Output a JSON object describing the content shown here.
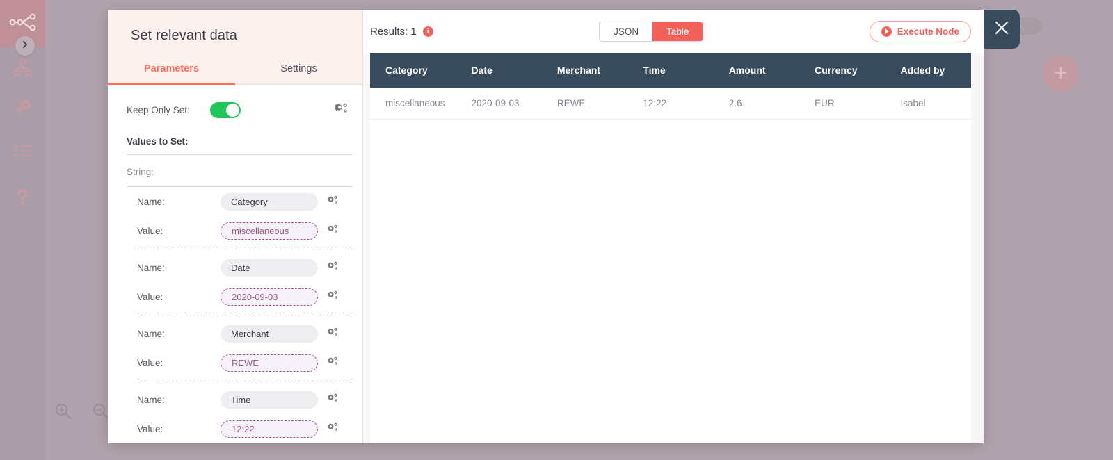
{
  "sidebar": {
    "logo_icon": "workflow-nodes-icon",
    "expand_icon": "chevron-right-icon",
    "items": [
      {
        "icon": "sitemap-icon",
        "name": "workflows"
      },
      {
        "icon": "key-icon",
        "name": "credentials"
      },
      {
        "icon": "checklist-icon",
        "name": "executions"
      },
      {
        "icon": "question-mark-icon",
        "name": "help"
      }
    ]
  },
  "canvas": {
    "zoom_in_icon": "zoom-in-icon",
    "zoom_out_icon": "zoom-out-icon",
    "add_icon": "plus-icon"
  },
  "modal": {
    "title": "Set relevant data",
    "tabs": [
      {
        "label": "Parameters",
        "active": true
      },
      {
        "label": "Settings",
        "active": false
      }
    ],
    "close_icon": "close-icon"
  },
  "parameters": {
    "keep_only_set": {
      "label": "Keep Only Set:",
      "value": "on",
      "options_icon": "cogs-icon"
    },
    "values_to_set_label": "Values to Set:",
    "string_label": "String:",
    "name_label": "Name:",
    "value_label": "Value:",
    "options_icon": "cogs-icon",
    "entries": [
      {
        "name": "Category",
        "value": "miscellaneous"
      },
      {
        "name": "Date",
        "value": "2020-09-03"
      },
      {
        "name": "Merchant",
        "value": "REWE"
      },
      {
        "name": "Time",
        "value": "12:22"
      }
    ]
  },
  "results": {
    "count_label": "Results: 1",
    "info_icon": "info-icon",
    "info_glyph": "i",
    "views": [
      {
        "label": "JSON",
        "active": false
      },
      {
        "label": "Table",
        "active": true
      }
    ],
    "execute_button": {
      "label": "Execute Node",
      "icon": "play-circle-icon"
    },
    "table": {
      "columns": [
        "Category",
        "Date",
        "Merchant",
        "Time",
        "Amount",
        "Currency",
        "Added by"
      ],
      "rows": [
        [
          "miscellaneous",
          "2020-09-03",
          "REWE",
          "12:22",
          "2.6",
          "EUR",
          "Isabel"
        ]
      ]
    }
  },
  "colors": {
    "accent": "#f4615a",
    "accent_light": "#ff6d5a",
    "table_header": "#374b5c",
    "toggle_on": "#1ec65a",
    "expression_border": "#a0538f",
    "expression_text": "#9b5a8c",
    "canvas": "#b0a3ad"
  }
}
